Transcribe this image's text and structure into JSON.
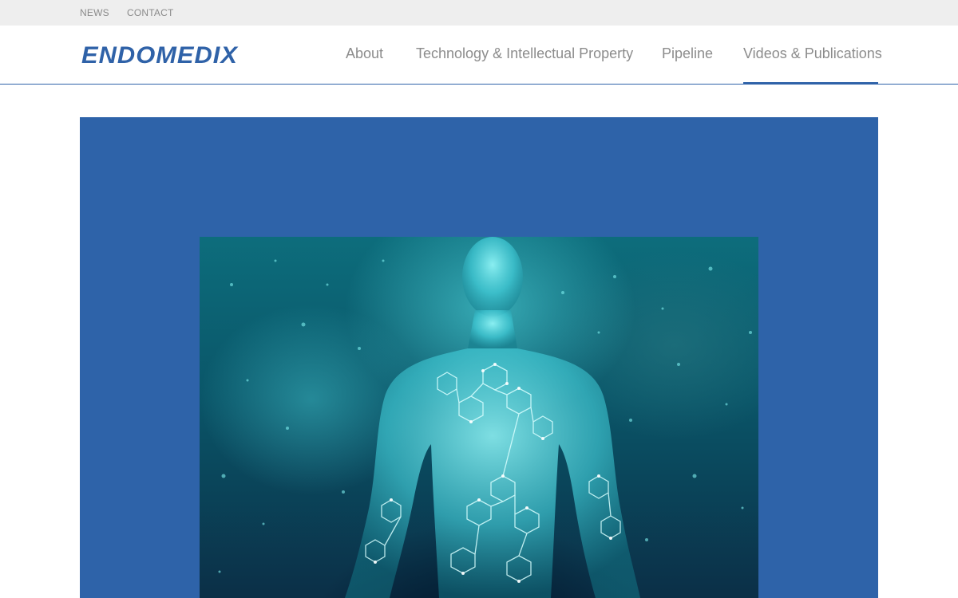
{
  "topbar": {
    "links": [
      "NEWS",
      "CONTACT"
    ]
  },
  "header": {
    "logo_text": "ENDOMEDIX",
    "nav": [
      {
        "label": "About",
        "active": false
      },
      {
        "label": "Technology & Intellectual Property",
        "active": false
      },
      {
        "label": "Pipeline",
        "active": false
      },
      {
        "label": "Videos & Publications",
        "active": true
      }
    ]
  },
  "hero": {
    "image_subject": "human-body-molecular-network-image"
  },
  "colors": {
    "brand_blue": "#2f62a8",
    "hero_background": "#2e63a9",
    "topbar_background": "#eeeeee",
    "nav_text": "#8c8c8c"
  }
}
